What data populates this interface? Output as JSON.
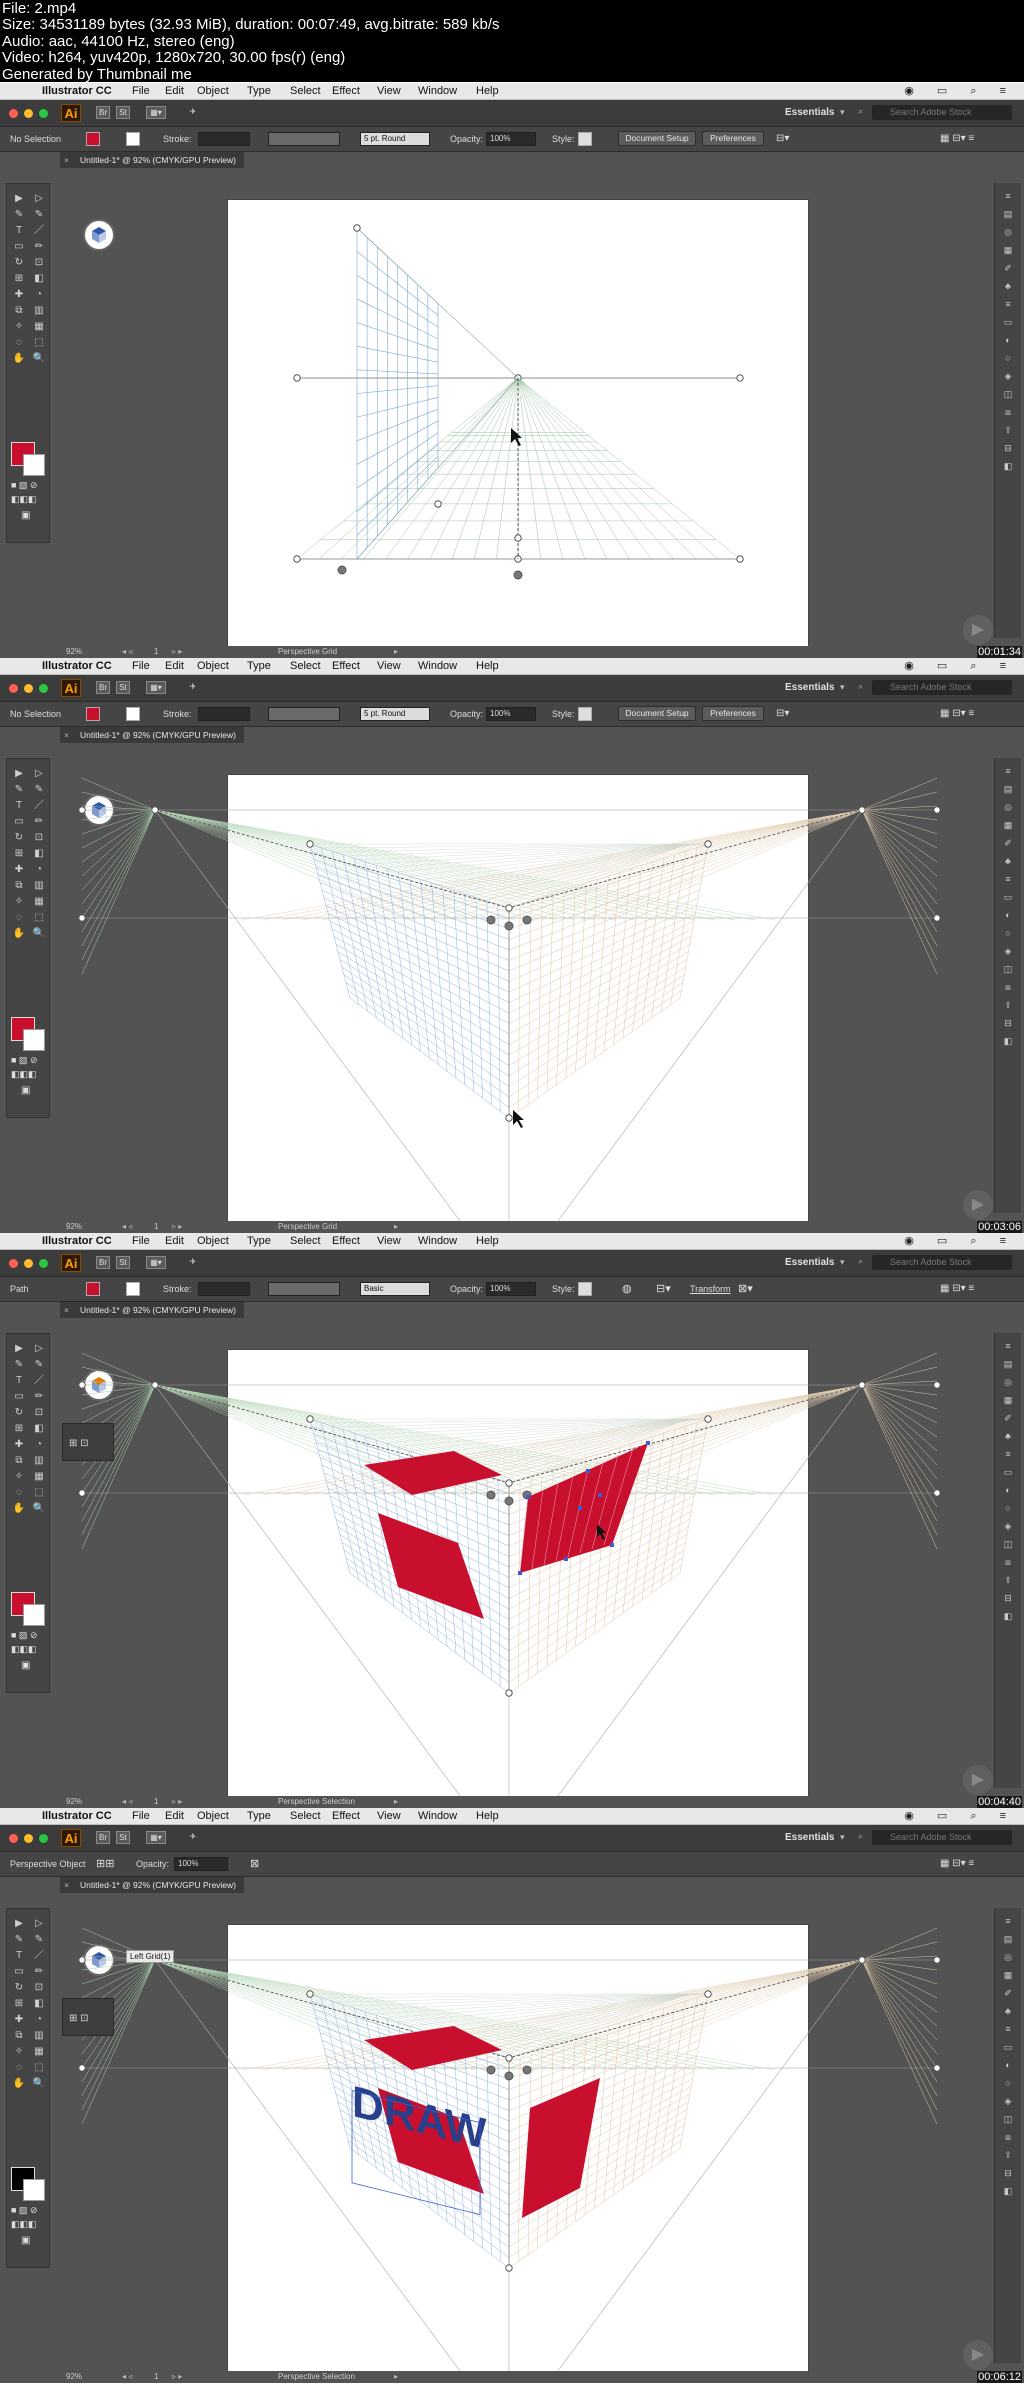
{
  "file_info": [
    "File: 2.mp4",
    "Size: 34531189 bytes (32.93 MiB), duration: 00:07:49, avg.bitrate: 589 kb/s",
    "Audio: aac, 44100 Hz, stereo (eng)",
    "Video: h264, yuv420p, 1280x720, 30.00 fps(r) (eng)",
    "Generated by Thumbnail me"
  ],
  "mac_menu": {
    "app_name": "Illustrator CC",
    "items": [
      "File",
      "Edit",
      "Object",
      "Type",
      "Select",
      "Effect",
      "View",
      "Window",
      "Help"
    ]
  },
  "app_bar": {
    "logo": "Ai",
    "bridge": "Br",
    "stock": "St",
    "workspace": "Essentials",
    "search_placeholder": "Search Adobe Stock"
  },
  "document_tab": "Untitled-1* @ 92% (CMYK/GPU Preview)",
  "colors": {
    "fill_red": "#c8102e",
    "accent": "#ff9a00",
    "ui_dark": "#535353"
  },
  "frames": [
    {
      "selection_label": "No Selection",
      "stroke_label": "Stroke:",
      "brush_value": "5 pt. Round",
      "opacity_label": "Opacity:",
      "opacity_value": "100%",
      "style_label": "Style:",
      "doc_setup": "Document Setup",
      "preferences": "Preferences",
      "zoom": "92%",
      "page": "1",
      "status_tool": "Perspective Grid",
      "timecode": "00:01:34",
      "fill_color": "red",
      "widget_color": "blue"
    },
    {
      "selection_label": "No Selection",
      "stroke_label": "Stroke:",
      "brush_value": "5 pt. Round",
      "opacity_label": "Opacity:",
      "opacity_value": "100%",
      "style_label": "Style:",
      "doc_setup": "Document Setup",
      "preferences": "Preferences",
      "zoom": "92%",
      "page": "1",
      "status_tool": "Perspective Grid",
      "timecode": "00:03:06",
      "fill_color": "red",
      "widget_color": "blue"
    },
    {
      "selection_label": "Path",
      "stroke_label": "Stroke:",
      "brush_value": "Basic",
      "opacity_label": "Opacity:",
      "opacity_value": "100%",
      "style_label": "Style:",
      "transform": "Transform",
      "zoom": "92%",
      "page": "1",
      "status_tool": "Perspective Selection",
      "timecode": "00:04:40",
      "fill_color": "red",
      "widget_color": "orange"
    },
    {
      "selection_label": "Perspective Object",
      "opacity_label": "Opacity:",
      "opacity_value": "100%",
      "tooltip": "Left Grid(1)",
      "canvas_text": "DRAW",
      "zoom": "92%",
      "page": "1",
      "status_tool": "Perspective Selection",
      "timecode": "00:06:12",
      "fill_color": "black",
      "widget_color": "blue"
    }
  ]
}
